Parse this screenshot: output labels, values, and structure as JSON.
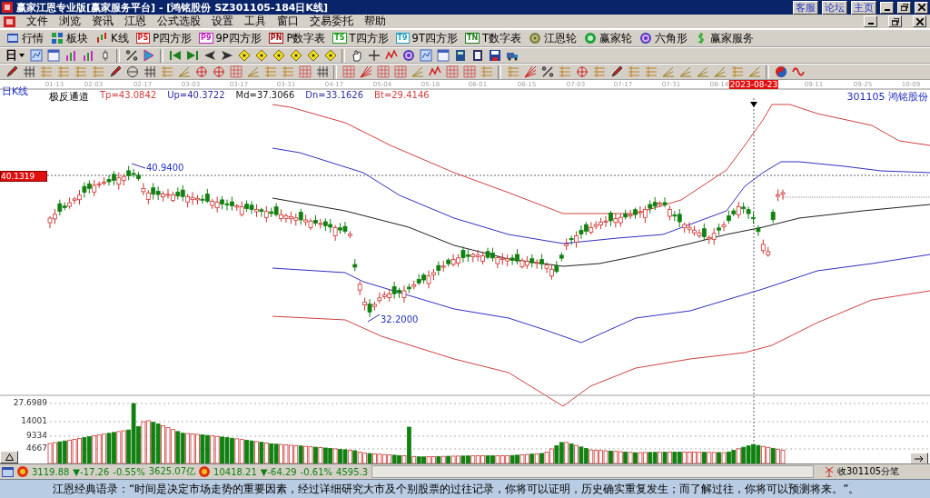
{
  "window": {
    "title": "赢家江恩专业版[赢家服务平台] - [鸿铭股份   SZ301105-184日K线]",
    "links": [
      "客服",
      "论坛",
      "主页"
    ]
  },
  "menu": [
    "文件",
    "浏览",
    "资讯",
    "江恩",
    "公式选股",
    "设置",
    "工具",
    "窗口",
    "交易委托",
    "帮助"
  ],
  "toolbar": [
    {
      "label": "行情",
      "kind": "quotes"
    },
    {
      "label": "板块",
      "kind": "sectors"
    },
    {
      "label": "K线",
      "kind": "kline"
    },
    {
      "label": "P四方形",
      "kind": "badge",
      "badge": "PS",
      "color": "#d02020"
    },
    {
      "label": "9P四方形",
      "kind": "badge",
      "badge": "P9",
      "color": "#c020c0"
    },
    {
      "label": "P数字表",
      "kind": "badge",
      "badge": "PN",
      "color": "#a01010"
    },
    {
      "label": "T四方形",
      "kind": "badge",
      "badge": "TS",
      "color": "#20a020"
    },
    {
      "label": "9T四方形",
      "kind": "badge",
      "badge": "T9",
      "color": "#20a0c0"
    },
    {
      "label": "T数字表",
      "kind": "badge",
      "badge": "TN",
      "color": "#208020"
    },
    {
      "label": "江恩轮",
      "kind": "wheel"
    },
    {
      "label": "赢家轮",
      "kind": "wheel2"
    },
    {
      "label": "六角形",
      "kind": "hexagon"
    },
    {
      "label": "赢家服务",
      "kind": "service"
    }
  ],
  "period_selector": {
    "value": "日"
  },
  "chart": {
    "period_label": "日K线",
    "indicator": "极反通道",
    "values": [
      {
        "text": "Tp=43.0842",
        "color": "#d04040"
      },
      {
        "text": "Up=40.3722",
        "color": "#3030a0"
      },
      {
        "text": "Md=37.3066",
        "color": "#202020"
      },
      {
        "text": "Dn=33.1626",
        "color": "#3030a0"
      },
      {
        "text": "Bt=29.4146",
        "color": "#d04040"
      }
    ],
    "stock": "301105  鸿铭股份",
    "dates": [
      "01-13",
      "02-03",
      "02-17",
      "03-03",
      "03-17",
      "03-31",
      "04-17",
      "05-04",
      "05-18",
      "06-01",
      "06-15",
      "07-03",
      "07-17",
      "07-31",
      "08-14",
      "09-11",
      "09-25",
      "10-09"
    ],
    "highlight_date": "2023-08-23",
    "price_tag": "40.1319",
    "high_label": "40.9400",
    "low_label": "32.2000"
  },
  "volume": {
    "ticks": [
      "27.6989",
      "14001",
      "9334",
      "4667"
    ]
  },
  "status_bar": {
    "indices": [
      {
        "value": "3119.88",
        "change": "▼-17.26",
        "percent": "-0.55%",
        "amount": "3625.07亿"
      },
      {
        "value": "10418.21",
        "change": "▼-64.29",
        "percent": "-0.61%",
        "amount": "4595.3"
      }
    ],
    "feed": "收301105分笔"
  },
  "quote": "江恩经典语录：“时间是决定市场走势的重要因素，经过详细研究大市及个别股票的过往记录，你将可以证明，历史确实重复发生；而了解过往，你将可以预测将来。”。"
}
